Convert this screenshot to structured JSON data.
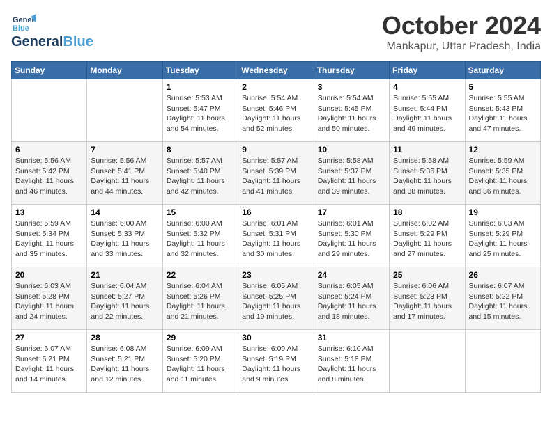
{
  "logo": {
    "line1": "General",
    "line2": "Blue"
  },
  "title": "October 2024",
  "location": "Mankapur, Uttar Pradesh, India",
  "days_of_week": [
    "Sunday",
    "Monday",
    "Tuesday",
    "Wednesday",
    "Thursday",
    "Friday",
    "Saturday"
  ],
  "weeks": [
    [
      {
        "day": "",
        "info": ""
      },
      {
        "day": "",
        "info": ""
      },
      {
        "day": "1",
        "info": "Sunrise: 5:53 AM\nSunset: 5:47 PM\nDaylight: 11 hours\nand 54 minutes."
      },
      {
        "day": "2",
        "info": "Sunrise: 5:54 AM\nSunset: 5:46 PM\nDaylight: 11 hours\nand 52 minutes."
      },
      {
        "day": "3",
        "info": "Sunrise: 5:54 AM\nSunset: 5:45 PM\nDaylight: 11 hours\nand 50 minutes."
      },
      {
        "day": "4",
        "info": "Sunrise: 5:55 AM\nSunset: 5:44 PM\nDaylight: 11 hours\nand 49 minutes."
      },
      {
        "day": "5",
        "info": "Sunrise: 5:55 AM\nSunset: 5:43 PM\nDaylight: 11 hours\nand 47 minutes."
      }
    ],
    [
      {
        "day": "6",
        "info": "Sunrise: 5:56 AM\nSunset: 5:42 PM\nDaylight: 11 hours\nand 46 minutes."
      },
      {
        "day": "7",
        "info": "Sunrise: 5:56 AM\nSunset: 5:41 PM\nDaylight: 11 hours\nand 44 minutes."
      },
      {
        "day": "8",
        "info": "Sunrise: 5:57 AM\nSunset: 5:40 PM\nDaylight: 11 hours\nand 42 minutes."
      },
      {
        "day": "9",
        "info": "Sunrise: 5:57 AM\nSunset: 5:39 PM\nDaylight: 11 hours\nand 41 minutes."
      },
      {
        "day": "10",
        "info": "Sunrise: 5:58 AM\nSunset: 5:37 PM\nDaylight: 11 hours\nand 39 minutes."
      },
      {
        "day": "11",
        "info": "Sunrise: 5:58 AM\nSunset: 5:36 PM\nDaylight: 11 hours\nand 38 minutes."
      },
      {
        "day": "12",
        "info": "Sunrise: 5:59 AM\nSunset: 5:35 PM\nDaylight: 11 hours\nand 36 minutes."
      }
    ],
    [
      {
        "day": "13",
        "info": "Sunrise: 5:59 AM\nSunset: 5:34 PM\nDaylight: 11 hours\nand 35 minutes."
      },
      {
        "day": "14",
        "info": "Sunrise: 6:00 AM\nSunset: 5:33 PM\nDaylight: 11 hours\nand 33 minutes."
      },
      {
        "day": "15",
        "info": "Sunrise: 6:00 AM\nSunset: 5:32 PM\nDaylight: 11 hours\nand 32 minutes."
      },
      {
        "day": "16",
        "info": "Sunrise: 6:01 AM\nSunset: 5:31 PM\nDaylight: 11 hours\nand 30 minutes."
      },
      {
        "day": "17",
        "info": "Sunrise: 6:01 AM\nSunset: 5:30 PM\nDaylight: 11 hours\nand 29 minutes."
      },
      {
        "day": "18",
        "info": "Sunrise: 6:02 AM\nSunset: 5:29 PM\nDaylight: 11 hours\nand 27 minutes."
      },
      {
        "day": "19",
        "info": "Sunrise: 6:03 AM\nSunset: 5:29 PM\nDaylight: 11 hours\nand 25 minutes."
      }
    ],
    [
      {
        "day": "20",
        "info": "Sunrise: 6:03 AM\nSunset: 5:28 PM\nDaylight: 11 hours\nand 24 minutes."
      },
      {
        "day": "21",
        "info": "Sunrise: 6:04 AM\nSunset: 5:27 PM\nDaylight: 11 hours\nand 22 minutes."
      },
      {
        "day": "22",
        "info": "Sunrise: 6:04 AM\nSunset: 5:26 PM\nDaylight: 11 hours\nand 21 minutes."
      },
      {
        "day": "23",
        "info": "Sunrise: 6:05 AM\nSunset: 5:25 PM\nDaylight: 11 hours\nand 19 minutes."
      },
      {
        "day": "24",
        "info": "Sunrise: 6:05 AM\nSunset: 5:24 PM\nDaylight: 11 hours\nand 18 minutes."
      },
      {
        "day": "25",
        "info": "Sunrise: 6:06 AM\nSunset: 5:23 PM\nDaylight: 11 hours\nand 17 minutes."
      },
      {
        "day": "26",
        "info": "Sunrise: 6:07 AM\nSunset: 5:22 PM\nDaylight: 11 hours\nand 15 minutes."
      }
    ],
    [
      {
        "day": "27",
        "info": "Sunrise: 6:07 AM\nSunset: 5:21 PM\nDaylight: 11 hours\nand 14 minutes."
      },
      {
        "day": "28",
        "info": "Sunrise: 6:08 AM\nSunset: 5:21 PM\nDaylight: 11 hours\nand 12 minutes."
      },
      {
        "day": "29",
        "info": "Sunrise: 6:09 AM\nSunset: 5:20 PM\nDaylight: 11 hours\nand 11 minutes."
      },
      {
        "day": "30",
        "info": "Sunrise: 6:09 AM\nSunset: 5:19 PM\nDaylight: 11 hours\nand 9 minutes."
      },
      {
        "day": "31",
        "info": "Sunrise: 6:10 AM\nSunset: 5:18 PM\nDaylight: 11 hours\nand 8 minutes."
      },
      {
        "day": "",
        "info": ""
      },
      {
        "day": "",
        "info": ""
      }
    ]
  ]
}
